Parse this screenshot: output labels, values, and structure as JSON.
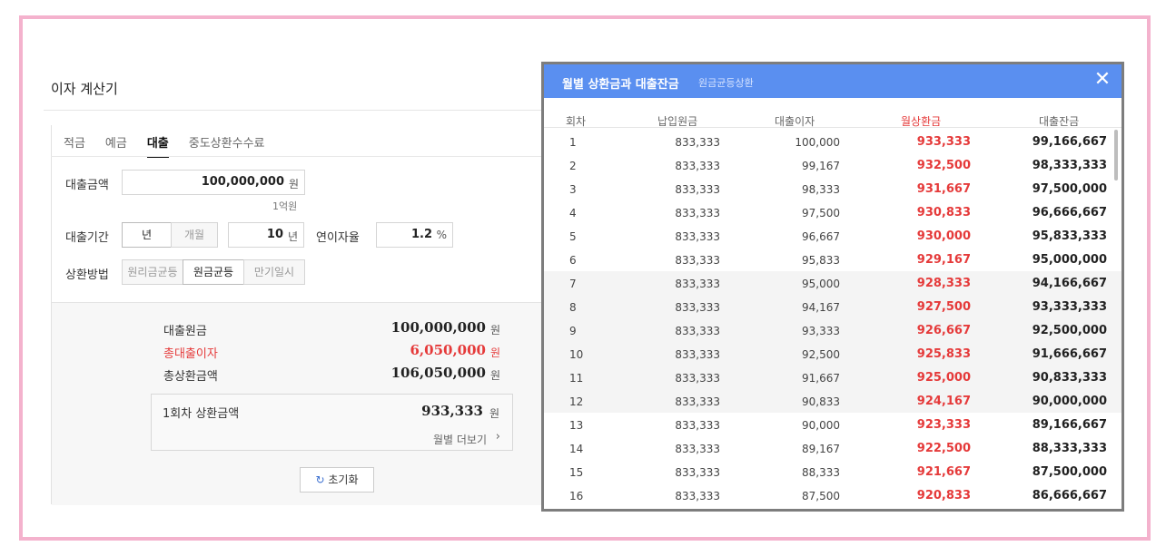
{
  "calculator": {
    "title": "이자 계산기",
    "tabs": [
      "적금",
      "예금",
      "대출",
      "중도상환수수료"
    ],
    "active_tab": "대출",
    "loan_amount_label": "대출금액",
    "loan_amount_value": "100,000,000",
    "loan_amount_unit": "원",
    "loan_amount_hint": "1억원",
    "loan_period_label": "대출기간",
    "period_year": "년",
    "period_month": "개월",
    "period_value": "10",
    "period_unit": "년",
    "rate_label": "연이자율",
    "rate_value": "1.2",
    "rate_unit": "%",
    "method_label": "상환방법",
    "methods": [
      "원리금균등",
      "원금균등",
      "만기일시"
    ],
    "selected_method": "원금균등",
    "result": {
      "principal_label": "대출원금",
      "principal_value": "100,000,000",
      "interest_label": "총대출이자",
      "interest_value": "6,050,000",
      "total_label": "총상환금액",
      "total_value": "106,050,000",
      "won": "원",
      "first_label": "1회차 상환금액",
      "first_value": "933,333",
      "more_link": "월별 더보기"
    },
    "reset_label": "초기화"
  },
  "modal": {
    "title": "월별 상환금과 대출잔금",
    "subtitle": "원금균등상환",
    "columns": [
      "회차",
      "납입원금",
      "대출이자",
      "월상환금",
      "대출잔금"
    ],
    "rows": [
      [
        "1",
        "833,333",
        "100,000",
        "933,333",
        "99,166,667"
      ],
      [
        "2",
        "833,333",
        "99,167",
        "932,500",
        "98,333,333"
      ],
      [
        "3",
        "833,333",
        "98,333",
        "931,667",
        "97,500,000"
      ],
      [
        "4",
        "833,333",
        "97,500",
        "930,833",
        "96,666,667"
      ],
      [
        "5",
        "833,333",
        "96,667",
        "930,000",
        "95,833,333"
      ],
      [
        "6",
        "833,333",
        "95,833",
        "929,167",
        "95,000,000"
      ],
      [
        "7",
        "833,333",
        "95,000",
        "928,333",
        "94,166,667"
      ],
      [
        "8",
        "833,333",
        "94,167",
        "927,500",
        "93,333,333"
      ],
      [
        "9",
        "833,333",
        "93,333",
        "926,667",
        "92,500,000"
      ],
      [
        "10",
        "833,333",
        "92,500",
        "925,833",
        "91,666,667"
      ],
      [
        "11",
        "833,333",
        "91,667",
        "925,000",
        "90,833,333"
      ],
      [
        "12",
        "833,333",
        "90,833",
        "924,167",
        "90,000,000"
      ],
      [
        "13",
        "833,333",
        "90,000",
        "923,333",
        "89,166,667"
      ],
      [
        "14",
        "833,333",
        "89,167",
        "922,500",
        "88,333,333"
      ],
      [
        "15",
        "833,333",
        "88,333",
        "921,667",
        "87,500,000"
      ],
      [
        "16",
        "833,333",
        "87,500",
        "920,833",
        "86,666,667"
      ]
    ]
  },
  "colors": {
    "header_blue": "#5a8ff0",
    "accent_red": "#e53a3a",
    "frame_pink": "#f4b2cd"
  }
}
